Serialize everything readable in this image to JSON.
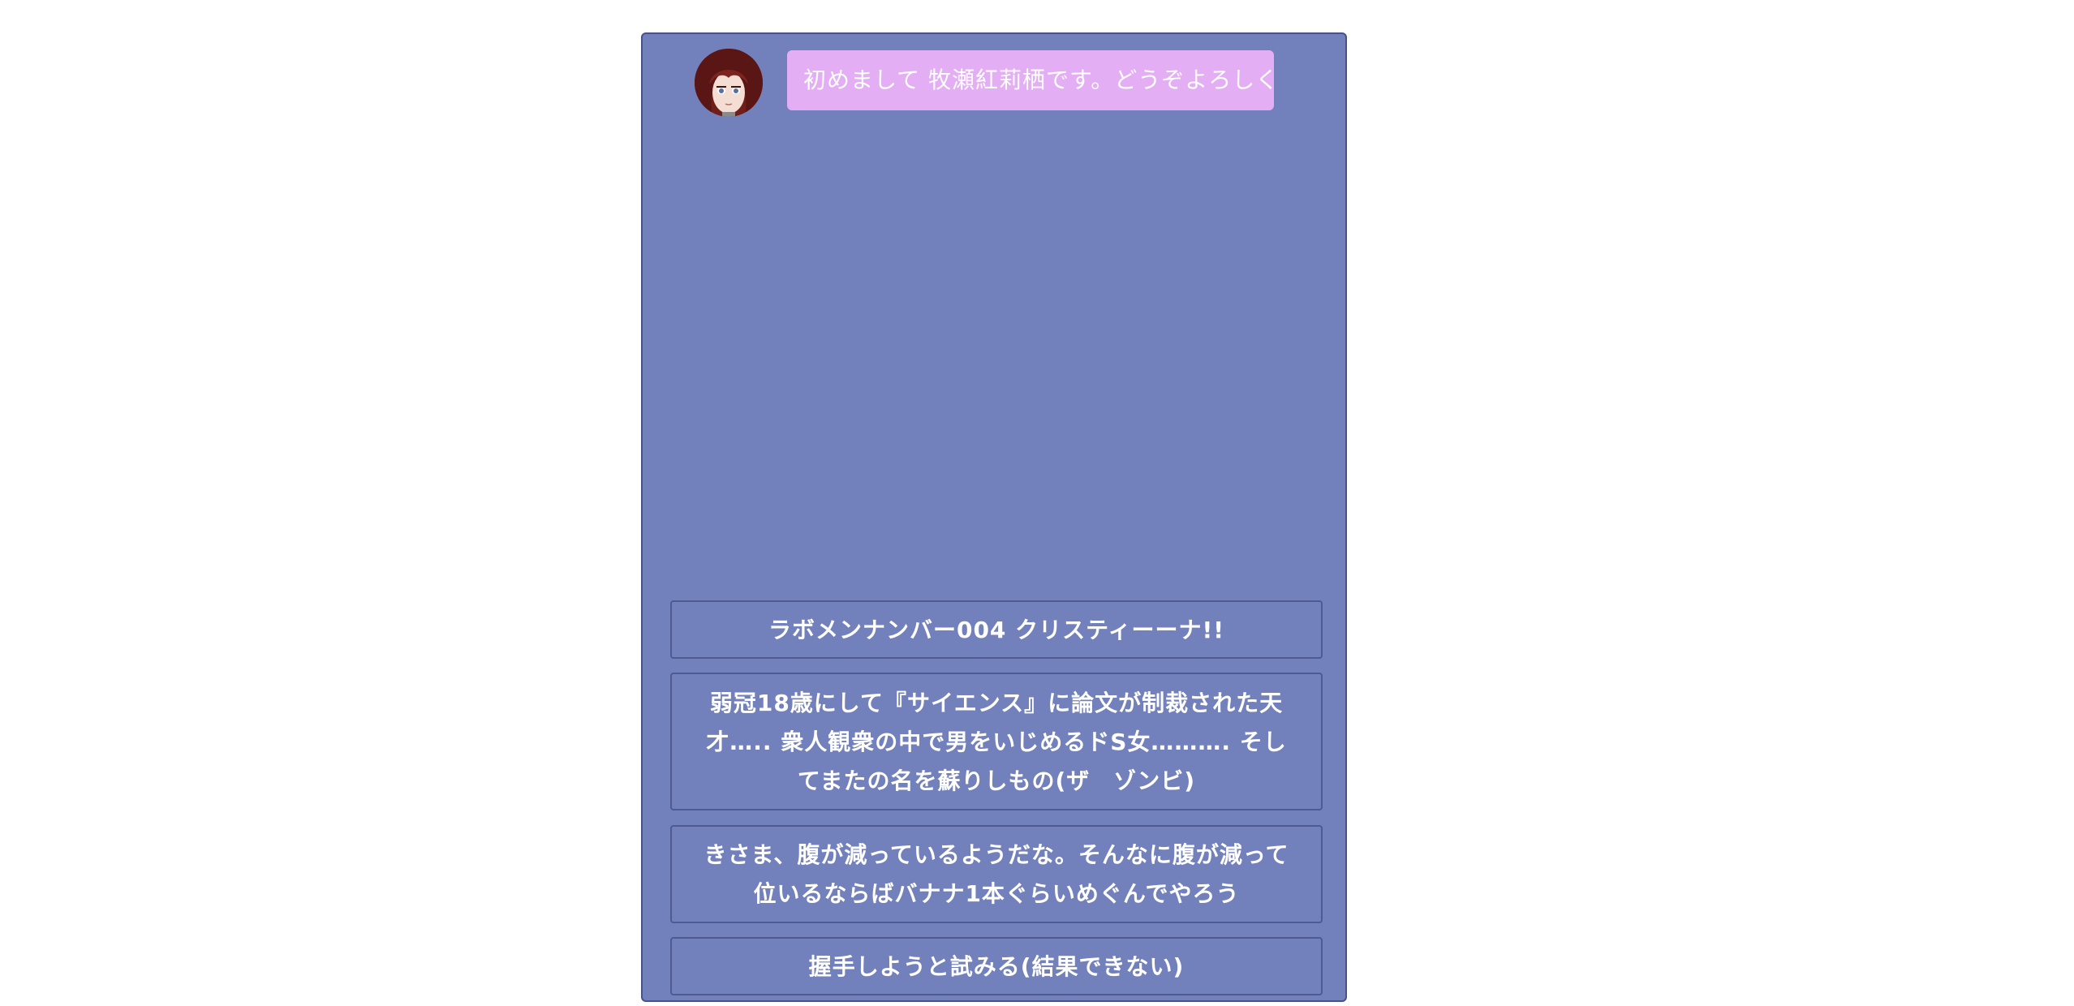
{
  "greeting": {
    "message": "初めまして 牧瀬紅莉栖です。どうぞよろしく"
  },
  "choices": [
    {
      "label": "ラボメンナンバー004 クリスティーーナ!!"
    },
    {
      "label": "弱冠18歳にして『サイエンス』に論文が制裁された天才….. 衆人観衆の中で男をいじめるドS女………. そしてまたの名を蘇りしもの(ザ　ゾンビ)"
    },
    {
      "label": "きさま、腹が減っているようだな。そんなに腹が減って位いるならばバナナ1本ぐらいめぐんでやろう"
    },
    {
      "label": "握手しようと試みる(結果できない)"
    }
  ],
  "colors": {
    "panel_background": "#7280bc",
    "panel_border": "#4a5282",
    "bubble_background": "#e3aef4",
    "text": "#ffffff"
  },
  "icons": {
    "avatar": "character-portrait"
  }
}
